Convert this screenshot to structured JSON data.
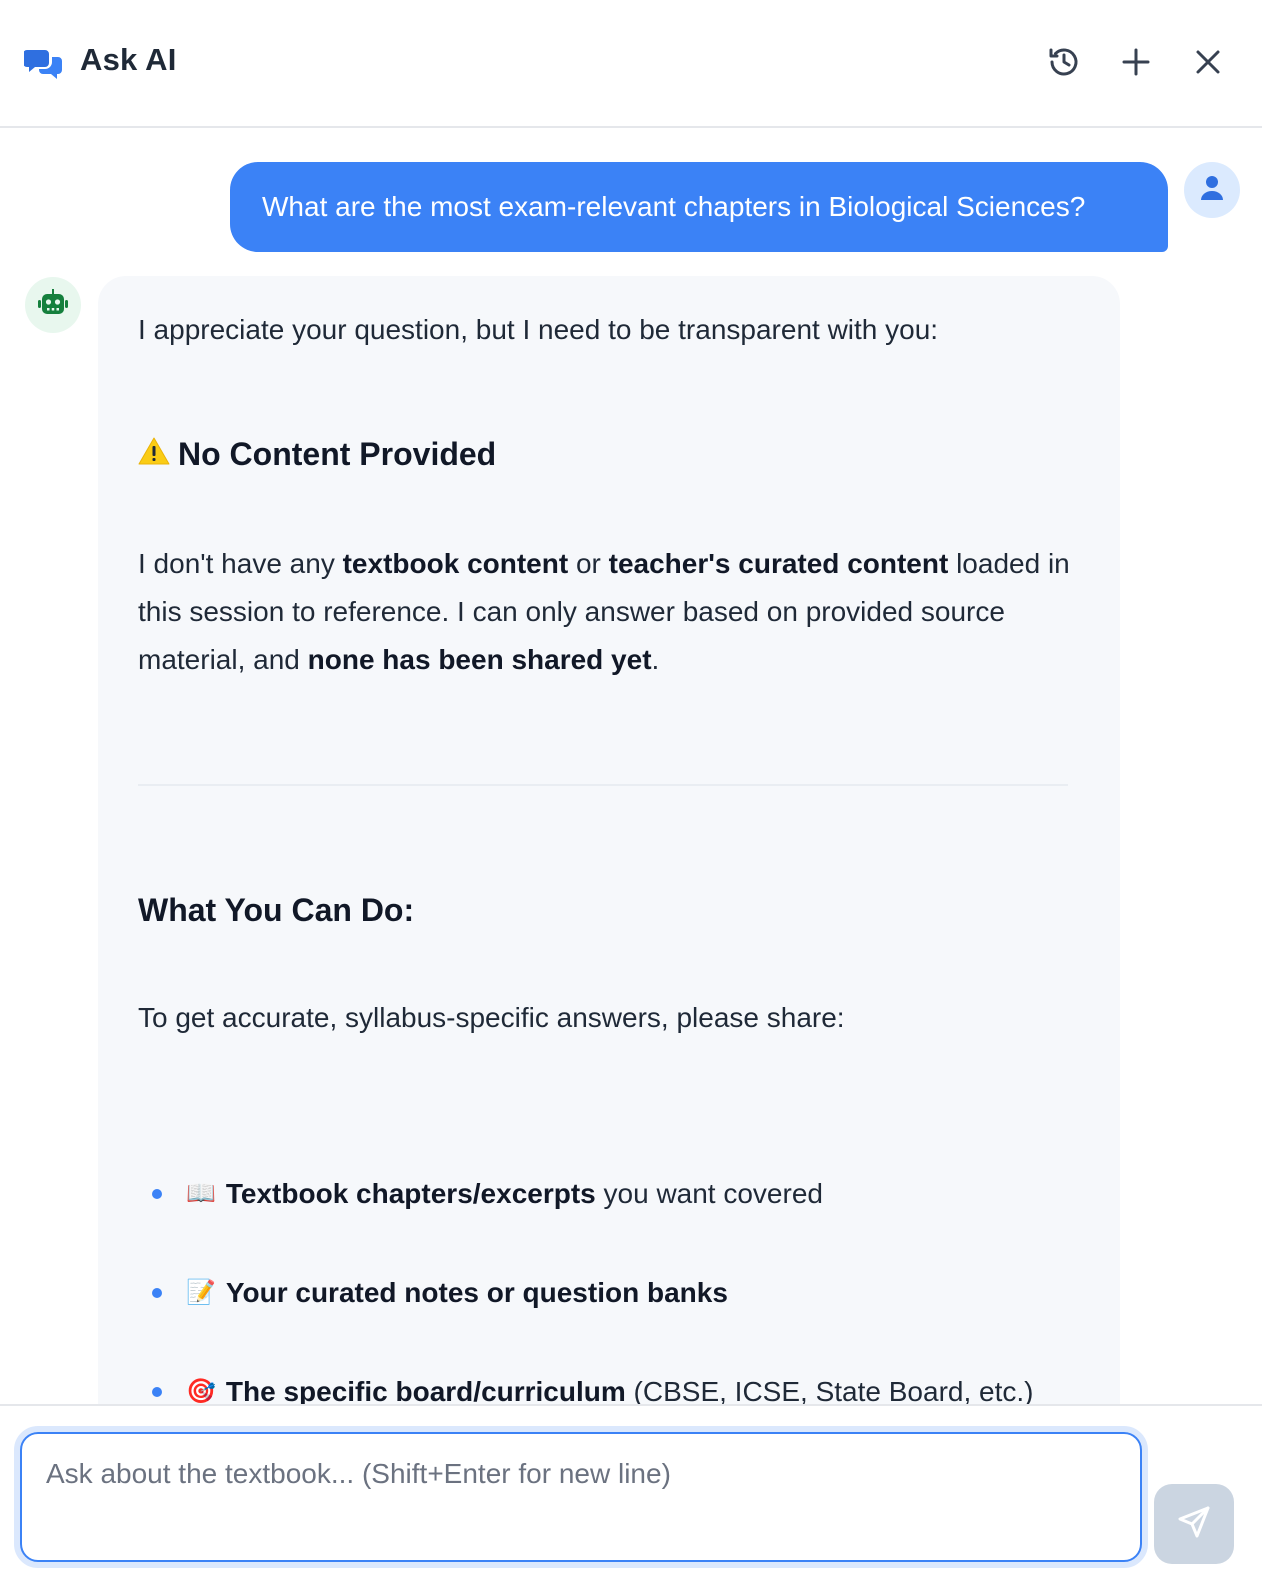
{
  "header": {
    "title": "Ask AI",
    "icons": {
      "logo": "chat-bubbles-icon",
      "history": "history-icon",
      "new": "plus-icon",
      "close": "close-icon"
    }
  },
  "chat": {
    "user_message": "What are the most exam-relevant chapters in Biological Sciences?",
    "bot": {
      "intro": "I appreciate your question, but I need to be transparent with you:",
      "warning_heading": "No Content Provided",
      "para1": {
        "t1": "I don't have any ",
        "b1": "textbook content",
        "t2": " or ",
        "b2": "teacher's curated content",
        "t3": " loaded in this session to reference. I can only answer based on provided source material, and ",
        "b3": "none has been shared yet",
        "t4": "."
      },
      "section_heading": "What You Can Do:",
      "para2": "To get accurate, syllabus-specific answers, please share:",
      "list": [
        {
          "emoji": "📖",
          "bold": "Textbook chapters/excerpts",
          "rest": " you want covered"
        },
        {
          "emoji": "📝",
          "bold": "Your curated notes or question banks",
          "rest": ""
        },
        {
          "emoji": "🎯",
          "bold": "The specific board/curriculum",
          "rest": " (CBSE, ICSE, State Board, etc.)"
        }
      ]
    }
  },
  "composer": {
    "placeholder": "Ask about the textbook... (Shift+Enter for new line)",
    "value": ""
  },
  "colors": {
    "accent": "#3b82f6",
    "bot_bg": "#f6f8fb",
    "send_disabled": "#cbd5e1"
  }
}
